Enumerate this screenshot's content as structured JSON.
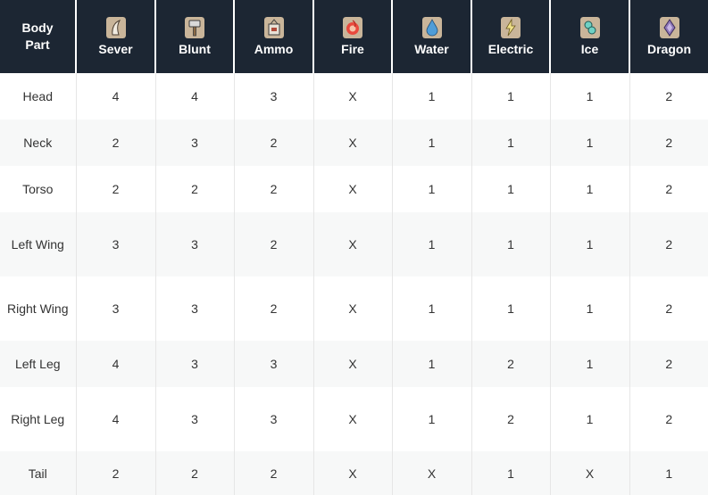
{
  "table": {
    "headers": {
      "body_part": "Body\nPart",
      "sever": "Sever",
      "blunt": "Blunt",
      "ammo": "Ammo",
      "fire": "Fire",
      "water": "Water",
      "electric": "Electric",
      "ice": "Ice",
      "dragon": "Dragon"
    },
    "icons": {
      "sever": "claw-icon",
      "blunt": "hammer-icon",
      "ammo": "ammo-box-icon",
      "fire": "flame-icon",
      "water": "water-drop-icon",
      "electric": "lightning-icon",
      "ice": "ice-crystal-icon",
      "dragon": "dragon-gem-icon"
    },
    "rows": [
      {
        "part": "Head",
        "sever": "4",
        "blunt": "4",
        "ammo": "3",
        "fire": "X",
        "water": "1",
        "electric": "1",
        "ice": "1",
        "dragon": "2"
      },
      {
        "part": "Neck",
        "sever": "2",
        "blunt": "3",
        "ammo": "2",
        "fire": "X",
        "water": "1",
        "electric": "1",
        "ice": "1",
        "dragon": "2"
      },
      {
        "part": "Torso",
        "sever": "2",
        "blunt": "2",
        "ammo": "2",
        "fire": "X",
        "water": "1",
        "electric": "1",
        "ice": "1",
        "dragon": "2"
      },
      {
        "part": "Left Wing",
        "sever": "3",
        "blunt": "3",
        "ammo": "2",
        "fire": "X",
        "water": "1",
        "electric": "1",
        "ice": "1",
        "dragon": "2"
      },
      {
        "part": "Right Wing",
        "sever": "3",
        "blunt": "3",
        "ammo": "2",
        "fire": "X",
        "water": "1",
        "electric": "1",
        "ice": "1",
        "dragon": "2"
      },
      {
        "part": "Left Leg",
        "sever": "4",
        "blunt": "3",
        "ammo": "3",
        "fire": "X",
        "water": "1",
        "electric": "2",
        "ice": "1",
        "dragon": "2"
      },
      {
        "part": "Right Leg",
        "sever": "4",
        "blunt": "3",
        "ammo": "3",
        "fire": "X",
        "water": "1",
        "electric": "2",
        "ice": "1",
        "dragon": "2"
      },
      {
        "part": "Tail",
        "sever": "2",
        "blunt": "2",
        "ammo": "2",
        "fire": "X",
        "water": "X",
        "electric": "1",
        "ice": "X",
        "dragon": "1"
      }
    ]
  },
  "colors": {
    "header_bg": "#1c2633",
    "header_text": "#ffffff",
    "stripe_bg": "#f7f8f8",
    "cell_text": "#333333"
  }
}
